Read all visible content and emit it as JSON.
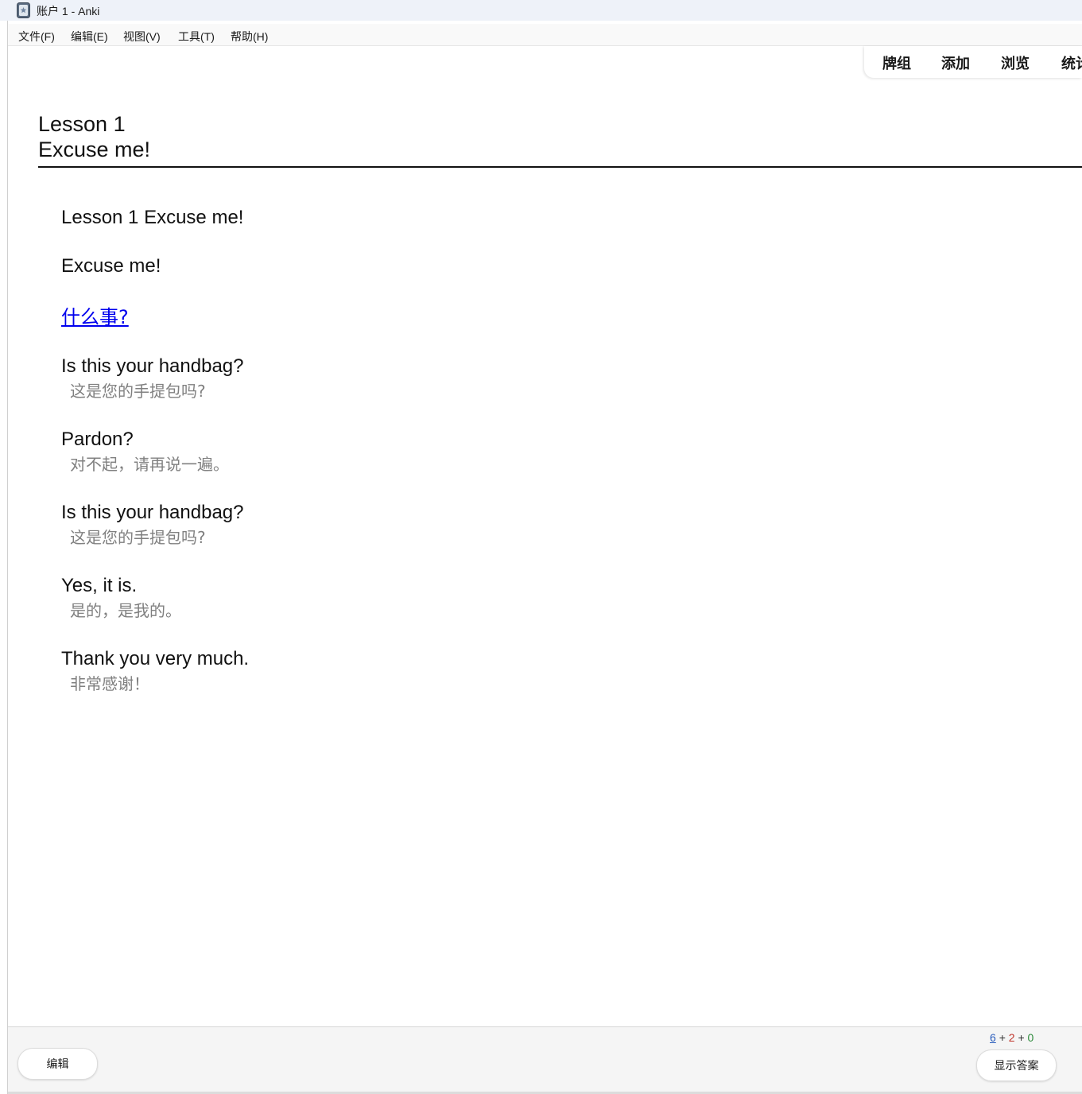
{
  "window": {
    "title": "账户 1 - Anki"
  },
  "menubar": {
    "items": [
      {
        "label": "文件(F)"
      },
      {
        "label": "编辑(E)"
      },
      {
        "label": "视图(V)"
      },
      {
        "label": "工具(T)"
      },
      {
        "label": "帮助(H)"
      }
    ]
  },
  "toolbar": {
    "tabs": [
      {
        "label": "牌组"
      },
      {
        "label": "添加"
      },
      {
        "label": "浏览"
      },
      {
        "label": "统计"
      }
    ]
  },
  "card": {
    "header_line1": "Lesson 1",
    "header_line2": "Excuse me!",
    "title_line": "Lesson 1 Excuse me!",
    "intro_line": "Excuse me!",
    "link_text": "什么事? ",
    "dialogue": [
      {
        "en": "Is this your handbag?",
        "cn": "这是您的手提包吗?"
      },
      {
        "en": "Pardon?",
        "cn": "对不起，请再说一遍。"
      },
      {
        "en": "Is this your handbag?",
        "cn": "这是您的手提包吗?"
      },
      {
        "en": "Yes, it is.",
        "cn": "是的，是我的。"
      },
      {
        "en": "Thank you very much.",
        "cn": "非常感谢！"
      }
    ]
  },
  "bottombar": {
    "edit_label": "编辑",
    "show_answer_label": "显示答案",
    "counts": {
      "new": "6",
      "learning": "2",
      "review": "0",
      "separator": "+"
    }
  },
  "colors": {
    "new_count": "#2a5dbc",
    "learn_count": "#c0352b",
    "review_count": "#2e8b3c",
    "link": "#0000ee",
    "translation": "#808080"
  }
}
